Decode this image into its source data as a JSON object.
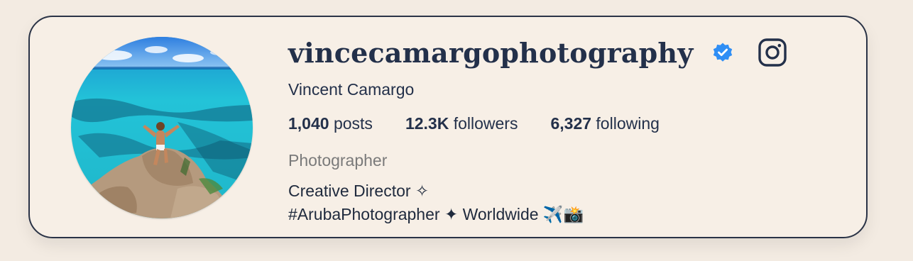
{
  "profile": {
    "username": "vincecamargophotography",
    "verified": true,
    "display_name": "Vincent Camargo",
    "stats": {
      "posts_count": "1,040",
      "posts_label": "posts",
      "followers_count": "12.3K",
      "followers_label": "followers",
      "following_count": "6,327",
      "following_label": "following"
    },
    "category": "Photographer",
    "bio_line_1": "Creative Director ✧",
    "bio_line_2": "#ArubaPhotographer ✦ Worldwide ✈️📸"
  },
  "icons": {
    "verified": "verified-badge-icon",
    "platform": "instagram-icon"
  },
  "colors": {
    "page_background": "#f3ebe2",
    "card_background": "#f7efe6",
    "text_primary": "#23304a",
    "text_muted": "#7a7a7a",
    "verified_blue": "#2f8ef5",
    "border": "#2a3346"
  }
}
